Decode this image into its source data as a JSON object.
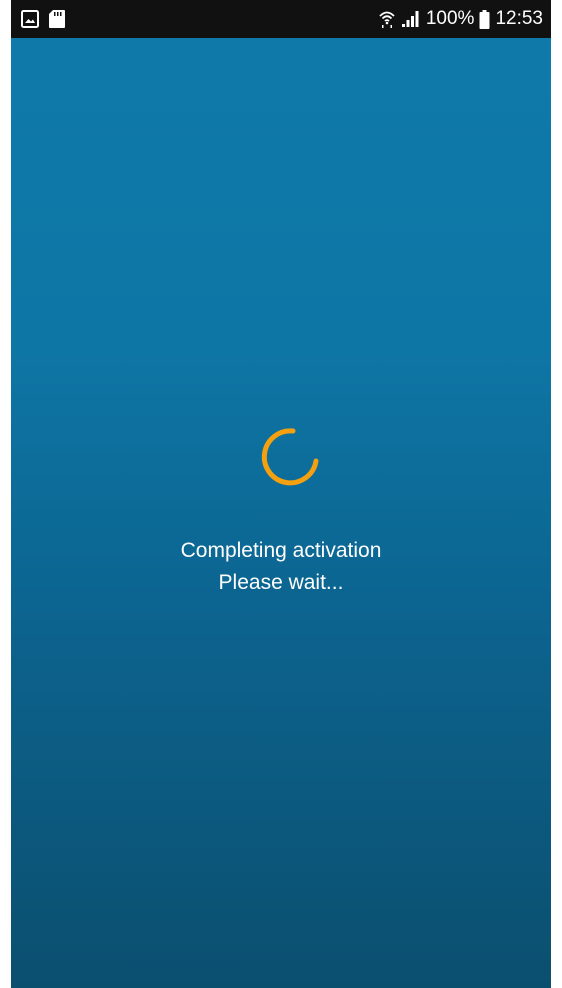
{
  "status_bar": {
    "battery_percent": "100%",
    "time": "12:53",
    "icons": [
      "image-icon",
      "sd-card-icon",
      "wifi-icon",
      "signal-icon",
      "battery-icon"
    ]
  },
  "loading": {
    "spinner_color": "#f5a00f",
    "line1": "Completing activation",
    "line2": "Please wait..."
  },
  "colors": {
    "background_top": "#0f7aab",
    "background_bottom": "#0b4f6f",
    "status_bar": "#111111",
    "text": "#ffffff"
  }
}
